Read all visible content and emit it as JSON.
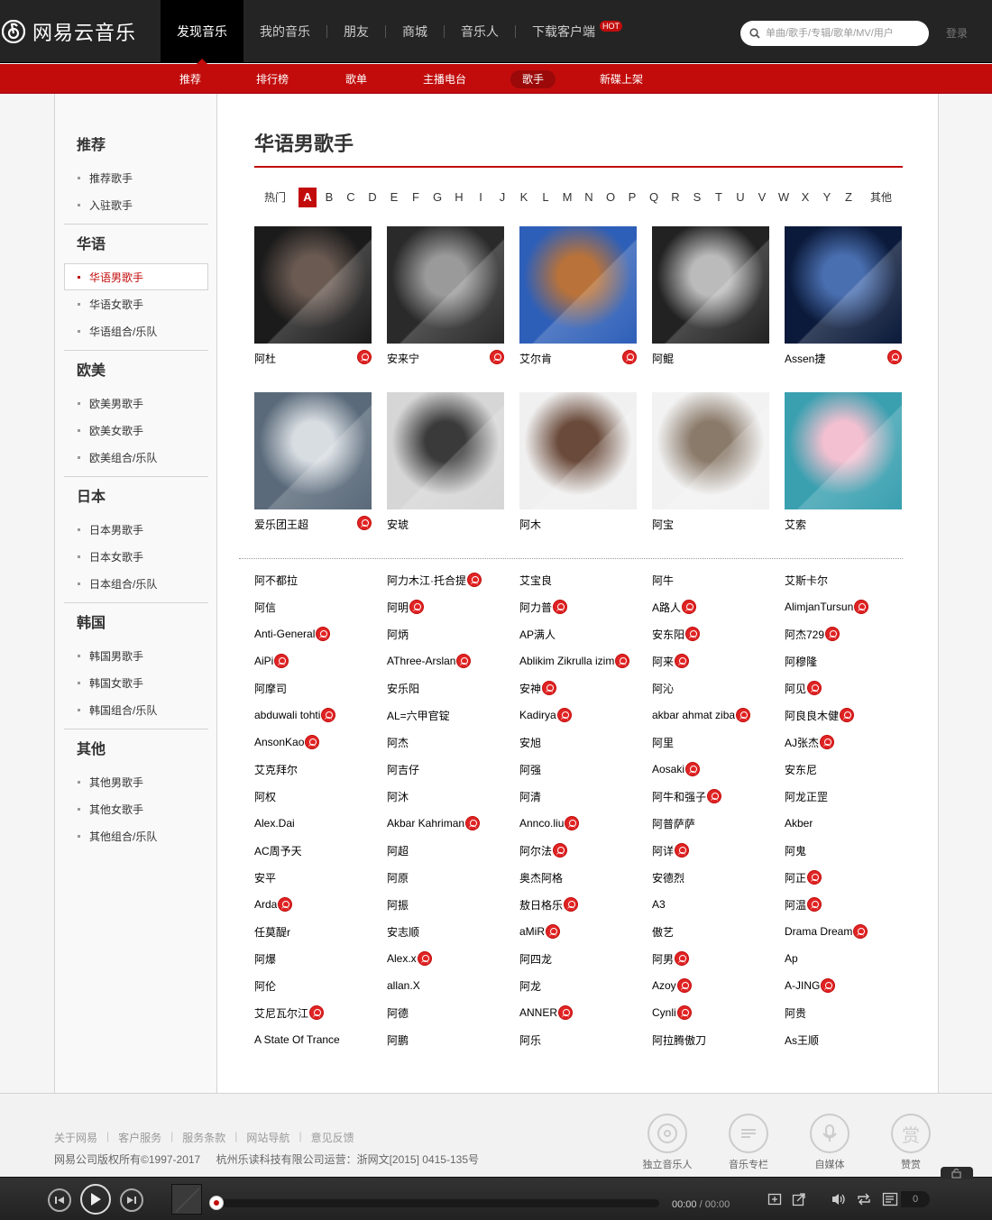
{
  "app": {
    "logo_text": "网易云音乐"
  },
  "nav": {
    "items": [
      "发现音乐",
      "我的音乐",
      "朋友",
      "商城",
      "音乐人",
      "下载客户端"
    ],
    "hot": "HOT",
    "login": "登录",
    "search_placeholder": "单曲/歌手/专辑/歌单/MV/用户"
  },
  "subnav": [
    "推荐",
    "排行榜",
    "歌单",
    "主播电台",
    "歌手",
    "新碟上架"
  ],
  "sidebar": [
    {
      "title": "推荐",
      "items": [
        "推荐歌手",
        "入驻歌手"
      ]
    },
    {
      "title": "华语",
      "items": [
        "华语男歌手",
        "华语女歌手",
        "华语组合/乐队"
      ]
    },
    {
      "title": "欧美",
      "items": [
        "欧美男歌手",
        "欧美女歌手",
        "欧美组合/乐队"
      ]
    },
    {
      "title": "日本",
      "items": [
        "日本男歌手",
        "日本女歌手",
        "日本组合/乐队"
      ]
    },
    {
      "title": "韩国",
      "items": [
        "韩国男歌手",
        "韩国女歌手",
        "韩国组合/乐队"
      ]
    },
    {
      "title": "其他",
      "items": [
        "其他男歌手",
        "其他女歌手",
        "其他组合/乐队"
      ]
    }
  ],
  "page": {
    "title": "华语男歌手"
  },
  "alphabet": [
    "热门",
    "A",
    "B",
    "C",
    "D",
    "E",
    "F",
    "G",
    "H",
    "I",
    "J",
    "K",
    "L",
    "M",
    "N",
    "O",
    "P",
    "Q",
    "R",
    "S",
    "T",
    "U",
    "V",
    "W",
    "X",
    "Y",
    "Z",
    "其他"
  ],
  "featured": [
    {
      "name": "阿杜",
      "verified": true,
      "colors": [
        "#1b1b1b",
        "#6a5a52"
      ]
    },
    {
      "name": "安来宁",
      "verified": true,
      "colors": [
        "#2a2a2a",
        "#9a9a9a"
      ]
    },
    {
      "name": "艾尔肯",
      "verified": true,
      "colors": [
        "#2e5fb8",
        "#b8723a"
      ]
    },
    {
      "name": "阿鲲",
      "verified": false,
      "colors": [
        "#222222",
        "#bbbbbb"
      ]
    },
    {
      "name": "Assen捷",
      "verified": true,
      "colors": [
        "#0b1a3a",
        "#4a6fb0"
      ]
    },
    {
      "name": "爱乐团王超",
      "verified": true,
      "colors": [
        "#5a6a7a",
        "#d8dde2"
      ]
    },
    {
      "name": "安琥",
      "verified": false,
      "colors": [
        "#d6d6d6",
        "#3a3a3a"
      ]
    },
    {
      "name": "阿木",
      "verified": false,
      "colors": [
        "#f0f0f0",
        "#6a4a3a"
      ]
    },
    {
      "name": "阿宝",
      "verified": false,
      "colors": [
        "#f2f2f2",
        "#8a7a6a"
      ]
    },
    {
      "name": "艾索",
      "verified": false,
      "colors": [
        "#3aa0b0",
        "#f2c0d0"
      ]
    }
  ],
  "artists": [
    [
      {
        "n": "阿不都拉",
        "v": false
      },
      {
        "n": "阿力木江·托合提",
        "v": true
      },
      {
        "n": "艾宝良",
        "v": false
      },
      {
        "n": "阿牛",
        "v": false
      },
      {
        "n": "艾斯卡尔",
        "v": false
      }
    ],
    [
      {
        "n": "阿信",
        "v": false
      },
      {
        "n": "阿明",
        "v": true
      },
      {
        "n": "阿力普",
        "v": true
      },
      {
        "n": "A路人",
        "v": true
      },
      {
        "n": "AlimjanTursun",
        "v": true
      }
    ],
    [
      {
        "n": "Anti-General",
        "v": true
      },
      {
        "n": "阿炳",
        "v": false
      },
      {
        "n": "AP满人",
        "v": false
      },
      {
        "n": "安东阳",
        "v": true
      },
      {
        "n": "阿杰729",
        "v": true
      }
    ],
    [
      {
        "n": "AiPi",
        "v": true
      },
      {
        "n": "AThree-Arslan",
        "v": true
      },
      {
        "n": "Ablikim Zikrulla izim",
        "v": true
      },
      {
        "n": "阿来",
        "v": true
      },
      {
        "n": "阿穆隆",
        "v": false
      }
    ],
    [
      {
        "n": "阿摩司",
        "v": false
      },
      {
        "n": "安乐阳",
        "v": false
      },
      {
        "n": "安神",
        "v": true
      },
      {
        "n": "阿沁",
        "v": false
      },
      {
        "n": "阿见",
        "v": true
      }
    ],
    [
      {
        "n": "abduwali tohti",
        "v": true
      },
      {
        "n": "AL=六甲官锭",
        "v": false
      },
      {
        "n": "Kadirya",
        "v": true
      },
      {
        "n": "akbar ahmat ziba",
        "v": true
      },
      {
        "n": "阿良良木健",
        "v": true
      }
    ],
    [
      {
        "n": "AnsonKao",
        "v": true
      },
      {
        "n": "阿杰",
        "v": false
      },
      {
        "n": "安旭",
        "v": false
      },
      {
        "n": "阿里",
        "v": false
      },
      {
        "n": "AJ张杰",
        "v": true
      }
    ],
    [
      {
        "n": "艾克拜尔",
        "v": false
      },
      {
        "n": "阿吉仔",
        "v": false
      },
      {
        "n": "阿强",
        "v": false
      },
      {
        "n": "Aosaki",
        "v": true
      },
      {
        "n": "安东尼",
        "v": false
      }
    ],
    [
      {
        "n": "阿权",
        "v": false
      },
      {
        "n": "阿沐",
        "v": false
      },
      {
        "n": "阿清",
        "v": false
      },
      {
        "n": "阿牛和强子",
        "v": true
      },
      {
        "n": "阿龙正罡",
        "v": false
      }
    ],
    [
      {
        "n": "Alex.Dai",
        "v": false
      },
      {
        "n": "Akbar Kahriman",
        "v": true
      },
      {
        "n": "Annco.liu",
        "v": true
      },
      {
        "n": "阿普萨萨",
        "v": false
      },
      {
        "n": "Akber",
        "v": false
      }
    ],
    [
      {
        "n": "AC周予天",
        "v": false
      },
      {
        "n": "阿超",
        "v": false
      },
      {
        "n": "阿尔法",
        "v": true
      },
      {
        "n": "阿详",
        "v": true
      },
      {
        "n": "阿鬼",
        "v": false
      }
    ],
    [
      {
        "n": "安平",
        "v": false
      },
      {
        "n": "阿原",
        "v": false
      },
      {
        "n": "奥杰阿格",
        "v": false
      },
      {
        "n": "安德烈",
        "v": false
      },
      {
        "n": "阿正",
        "v": true
      }
    ],
    [
      {
        "n": "Arda",
        "v": true
      },
      {
        "n": "阿振",
        "v": false
      },
      {
        "n": "敖日格乐",
        "v": true
      },
      {
        "n": "A3",
        "v": false
      },
      {
        "n": "阿温",
        "v": true
      }
    ],
    [
      {
        "n": "任莫醍r",
        "v": false
      },
      {
        "n": "安志顺",
        "v": false
      },
      {
        "n": "aMiR",
        "v": true
      },
      {
        "n": "傲艺",
        "v": false
      },
      {
        "n": "Drama Dream",
        "v": true
      }
    ],
    [
      {
        "n": "阿爆",
        "v": false
      },
      {
        "n": "Alex.x",
        "v": true
      },
      {
        "n": "阿四龙",
        "v": false
      },
      {
        "n": "阿男",
        "v": true
      },
      {
        "n": "Ap",
        "v": false
      }
    ],
    [
      {
        "n": "阿伦",
        "v": false
      },
      {
        "n": "allan.X",
        "v": false
      },
      {
        "n": "阿龙",
        "v": false
      },
      {
        "n": "Azoy",
        "v": true
      },
      {
        "n": "A-JING",
        "v": true
      }
    ],
    [
      {
        "n": "艾尼瓦尔江",
        "v": true
      },
      {
        "n": "阿德",
        "v": false
      },
      {
        "n": "ANNER",
        "v": true
      },
      {
        "n": "Cynli",
        "v": true
      },
      {
        "n": "阿贵",
        "v": false
      }
    ],
    [
      {
        "n": "A State Of Trance",
        "v": false
      },
      {
        "n": "阿鹏",
        "v": false
      },
      {
        "n": "阿乐",
        "v": false
      },
      {
        "n": "阿拉腾傲刀",
        "v": false
      },
      {
        "n": "As王顺",
        "v": false
      }
    ]
  ],
  "footer": {
    "links": [
      "关于网易",
      "客户服务",
      "服务条款",
      "网站导航",
      "意见反馈"
    ],
    "copyright": "网易公司版权所有©1997-2017",
    "operator": "杭州乐读科技有限公司运营：浙网文[2015] 0415-135号",
    "icons": [
      {
        "label": "独立音乐人",
        "icon": "vinyl-icon"
      },
      {
        "label": "音乐专栏",
        "icon": "column-icon"
      },
      {
        "label": "自媒体",
        "icon": "microphone-icon"
      },
      {
        "label": "赞赏",
        "icon": "reward-icon",
        "glyph": "赏"
      }
    ]
  },
  "player": {
    "current": "00:00",
    "total": "/ 00:00",
    "playlist_count": "0",
    "progress": 0
  }
}
